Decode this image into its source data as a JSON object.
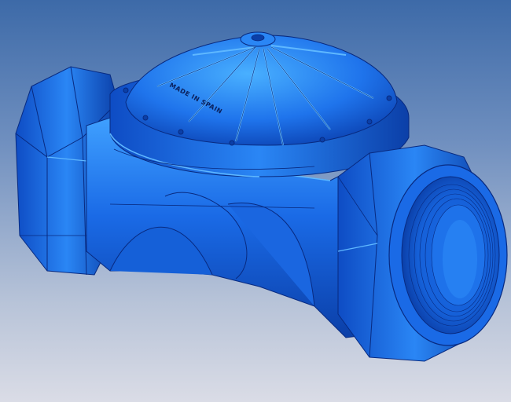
{
  "scene": {
    "object": "valve-body-render",
    "colors": {
      "background_top": "#3d6aa8",
      "background_bottom": "#dadce6",
      "body_base": "#1a6ae6",
      "body_highlight": "#3fa0ff",
      "body_shadow": "#0b3fa8",
      "edge_line": "#082a80"
    },
    "embossed_text": "MADE IN SPAIN"
  }
}
